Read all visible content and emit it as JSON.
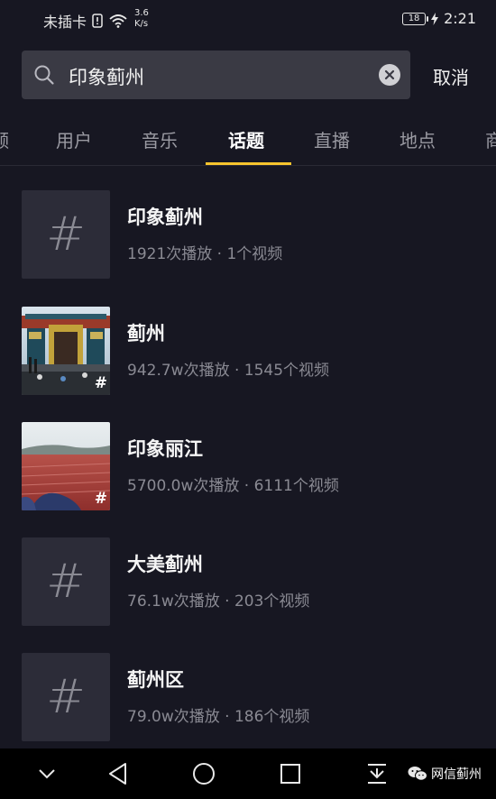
{
  "status_bar": {
    "carrier": "未插卡",
    "speed_value": "3.6",
    "speed_unit": "K/s",
    "battery": "18",
    "time": "2:21"
  },
  "search": {
    "query": "印象蓟州",
    "cancel_label": "取消"
  },
  "tabs": [
    {
      "label": "频",
      "active": false
    },
    {
      "label": "用户",
      "active": false
    },
    {
      "label": "音乐",
      "active": false
    },
    {
      "label": "话题",
      "active": true
    },
    {
      "label": "直播",
      "active": false
    },
    {
      "label": "地点",
      "active": false
    },
    {
      "label": "商",
      "active": false
    }
  ],
  "topics": [
    {
      "title": "印象蓟州",
      "stats": "1921次播放 · 1个视频",
      "thumb": "hash"
    },
    {
      "title": "蓟州",
      "stats": "942.7w次播放 · 1545个视频",
      "thumb": "gate-photo"
    },
    {
      "title": "印象丽江",
      "stats": "5700.0w次播放 · 6111个视频",
      "thumb": "field-photo"
    },
    {
      "title": "大美蓟州",
      "stats": "76.1w次播放 · 203个视频",
      "thumb": "hash"
    },
    {
      "title": "蓟州区",
      "stats": "79.0w次播放 · 186个视频",
      "thumb": "hash"
    }
  ],
  "hash_symbol": "#",
  "nav": {
    "icons": [
      "chevron-down-icon",
      "back-icon",
      "home-icon",
      "recents-icon",
      "download-icon"
    ],
    "watermark": "网信蓟州"
  },
  "colors": {
    "background": "#171722",
    "accent_underline": "#f8c42e",
    "search_bg": "#3a3a44"
  }
}
